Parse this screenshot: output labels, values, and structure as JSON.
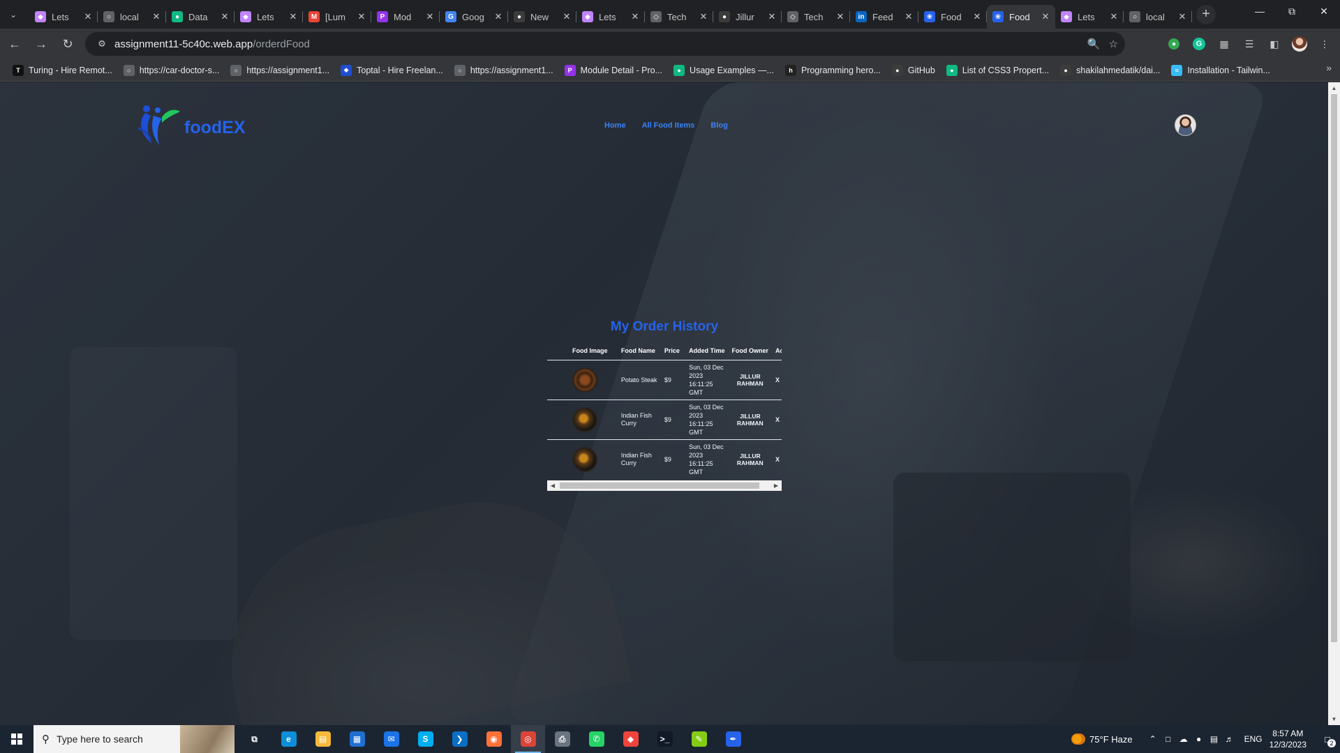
{
  "browser": {
    "tabs": [
      {
        "title": "Lets",
        "favicon": "lets-icon",
        "color": "#c084fc",
        "glyph": "◆"
      },
      {
        "title": "local",
        "favicon": "globe-icon",
        "color": "#5f6368",
        "glyph": "○"
      },
      {
        "title": "Data",
        "favicon": "mongodb-icon",
        "color": "#10b981",
        "glyph": "●"
      },
      {
        "title": "Lets",
        "favicon": "lets-icon",
        "color": "#c084fc",
        "glyph": "◆"
      },
      {
        "title": "[Lum",
        "favicon": "gmail-icon",
        "color": "#ea4335",
        "glyph": "M"
      },
      {
        "title": "Mod",
        "favicon": "module-icon",
        "color": "#9333ea",
        "glyph": "P"
      },
      {
        "title": "Goog",
        "favicon": "google-icon",
        "color": "#4285f4",
        "glyph": "G"
      },
      {
        "title": "New",
        "favicon": "github-icon",
        "color": "#3c3c3c",
        "glyph": "●"
      },
      {
        "title": "Lets",
        "favicon": "lets-icon",
        "color": "#c084fc",
        "glyph": "◆"
      },
      {
        "title": "Tech",
        "favicon": "tech-icon",
        "color": "#5f6368",
        "glyph": "◇"
      },
      {
        "title": "Jillur",
        "favicon": "github-icon",
        "color": "#3c3c3c",
        "glyph": "●"
      },
      {
        "title": "Tech",
        "favicon": "tech-icon",
        "color": "#5f6368",
        "glyph": "◇"
      },
      {
        "title": "Feed",
        "favicon": "linkedin-icon",
        "color": "#0a66c2",
        "glyph": "in"
      },
      {
        "title": "Food",
        "favicon": "foodex-icon",
        "color": "#2563eb",
        "glyph": "❀"
      },
      {
        "title": "Food",
        "favicon": "foodex-icon",
        "color": "#2563eb",
        "glyph": "❀",
        "active": true
      },
      {
        "title": "Lets",
        "favicon": "lets-icon",
        "color": "#c084fc",
        "glyph": "◆"
      },
      {
        "title": "local",
        "favicon": "globe-icon",
        "color": "#5f6368",
        "glyph": "○"
      }
    ],
    "url_host": "assignment11-5c40c.web.app",
    "url_path": "/orderdFood",
    "bookmarks": [
      {
        "label": "Turing - Hire Remot...",
        "favicon": "turing-icon",
        "color": "#111",
        "glyph": "T"
      },
      {
        "label": "https://car-doctor-s...",
        "favicon": "globe-icon",
        "color": "#5f6368",
        "glyph": "○"
      },
      {
        "label": "https://assignment1...",
        "favicon": "globe-icon",
        "color": "#5f6368",
        "glyph": "○"
      },
      {
        "label": "Toptal - Hire Freelan...",
        "favicon": "toptal-icon",
        "color": "#204ecf",
        "glyph": "◆"
      },
      {
        "label": "https://assignment1...",
        "favicon": "globe-icon",
        "color": "#5f6368",
        "glyph": "○"
      },
      {
        "label": "Module Detail - Pro...",
        "favicon": "module-icon",
        "color": "#9333ea",
        "glyph": "P"
      },
      {
        "label": "Usage Examples —...",
        "favicon": "mongodb-icon",
        "color": "#10b981",
        "glyph": "●"
      },
      {
        "label": "Programming hero...",
        "favicon": "ph-icon",
        "color": "#222",
        "glyph": "h"
      },
      {
        "label": "GitHub",
        "favicon": "github-icon",
        "color": "#3c3c3c",
        "glyph": "●"
      },
      {
        "label": "List of CSS3 Propert...",
        "favicon": "css-icon",
        "color": "#10b981",
        "glyph": "●"
      },
      {
        "label": "shakilahmedatik/dai...",
        "favicon": "github-icon",
        "color": "#3c3c3c",
        "glyph": "●"
      },
      {
        "label": "Installation - Tailwin...",
        "favicon": "tailwind-icon",
        "color": "#38bdf8",
        "glyph": "≈"
      }
    ]
  },
  "site": {
    "brand": "foodEX",
    "nav": [
      "Home",
      "All Food Items",
      "Blog"
    ],
    "page_title": "My Order History",
    "columns": [
      "Food Image",
      "Food Name",
      "Price",
      "Added Time",
      "Food Owner",
      "Action"
    ],
    "orders": [
      {
        "image": "potato-steak-image",
        "name": "Potato Steak",
        "price": "$9",
        "time": "Sun, 03 Dec 2023 16:11:25 GMT",
        "owner": "JILLUR RAHMAN",
        "action": "X"
      },
      {
        "image": "fish-curry-image",
        "name": "Indian Fish Curry",
        "price": "$9",
        "time": "Sun, 03 Dec 2023 16:11:25 GMT",
        "owner": "JILLUR RAHMAN",
        "action": "X"
      },
      {
        "image": "fish-curry-image",
        "name": "Indian Fish Curry",
        "price": "$9",
        "time": "Sun, 03 Dec 2023 16:11:25 GMT",
        "owner": "JILLUR RAHMAN",
        "action": "X"
      }
    ],
    "colors": {
      "brand_blue": "#2563eb",
      "nav_blue": "#3b82f6"
    }
  },
  "taskbar": {
    "search_placeholder": "Type here to search",
    "apps": [
      {
        "name": "task-view-icon",
        "glyph": "⧉",
        "color": "transparent"
      },
      {
        "name": "edge-icon",
        "glyph": "e",
        "color": "#0c8ed9"
      },
      {
        "name": "file-explorer-icon",
        "glyph": "▤",
        "color": "#f6b93b"
      },
      {
        "name": "store-icon",
        "glyph": "▦",
        "color": "#1f6fd1"
      },
      {
        "name": "mail-icon",
        "glyph": "✉",
        "color": "#1a73e8"
      },
      {
        "name": "skype-icon",
        "glyph": "S",
        "color": "#00aff0"
      },
      {
        "name": "vscode-icon",
        "glyph": "❯",
        "color": "#0a6fc4"
      },
      {
        "name": "firefox-icon",
        "glyph": "◉",
        "color": "#ff7139"
      },
      {
        "name": "chrome-icon",
        "glyph": "◎",
        "color": "#db4437",
        "active": true
      },
      {
        "name": "printer-icon",
        "glyph": "⎙",
        "color": "#6b7280"
      },
      {
        "name": "whatsapp-icon",
        "glyph": "✆",
        "color": "#25d366"
      },
      {
        "name": "anydesk-icon",
        "glyph": "◆",
        "color": "#ef443b"
      },
      {
        "name": "terminal-icon",
        "glyph": ">_",
        "color": "#111827"
      },
      {
        "name": "notepad-icon",
        "glyph": "✎",
        "color": "#84cc16"
      },
      {
        "name": "paint-icon",
        "glyph": "✒",
        "color": "#2563eb"
      }
    ],
    "weather": "75°F  Haze",
    "lang": "ENG",
    "time": "8:57 AM",
    "date": "12/3/2023",
    "notifications": "2"
  }
}
